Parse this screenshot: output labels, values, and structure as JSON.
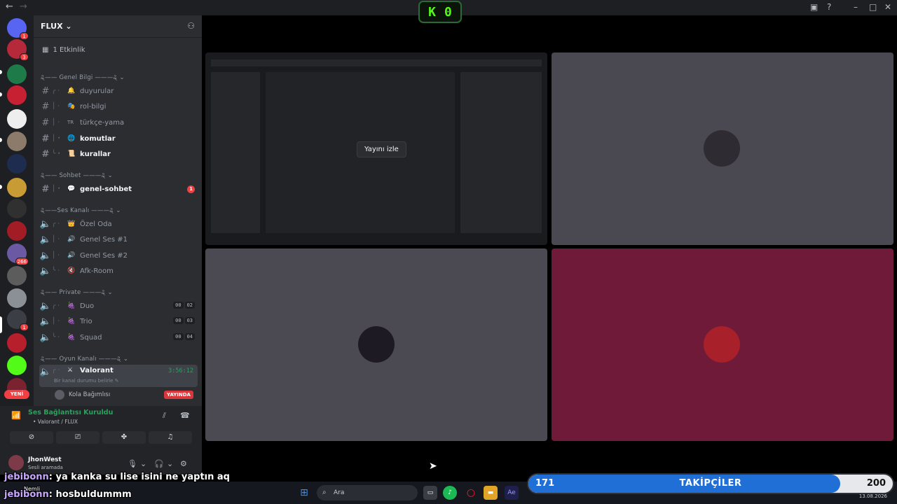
{
  "server": {
    "name": "FLUX",
    "events": "1 Etkinlik"
  },
  "guild_badges": {
    "discord": "1",
    "m": "3",
    "community": "266",
    "app": "1"
  },
  "new_label": "YENİ",
  "categories": {
    "genel": "ୡ—— Genel Bilgi ———ୡ ⌄",
    "sohbet": "ୡ—— Sohbet ———ୡ ⌄",
    "ses": "ୡ——Ses Kanalı ———ୡ ⌄",
    "private": "ୡ—— Private ———ୡ ⌄",
    "oyun": "ୡ—— Oyun Kanalı ———ୡ ⌄"
  },
  "channels": {
    "duyurular": "duyurular",
    "rol_bilgi": "rol-bilgi",
    "turkce_yama": "türkçe-yama",
    "turkce_prefix": "TR",
    "komutlar": "komutlar",
    "kurallar": "kurallar",
    "genel_sohbet": "genel-sohbet",
    "genel_sohbet_badge": "1",
    "ozel_oda": "Özel Oda",
    "genel_ses_1": "Genel Ses #1",
    "genel_ses_2": "Genel Ses #2",
    "afk_room": "Afk-Room",
    "duo": "Duo",
    "duo_count": [
      "00",
      "02"
    ],
    "trio": "Trio",
    "trio_count": [
      "00",
      "03"
    ],
    "squad": "Squad",
    "squad_count": [
      "00",
      "04"
    ],
    "valorant": "Valorant",
    "valorant_timer": "3:56:12",
    "valorant_status": "Bir kanal durumu belirle",
    "voice_user": "Kola Bağımlısı",
    "live_label": "YAYINDA"
  },
  "voice_panel": {
    "status": "Ses Bağlantısı Kuruldu",
    "location": "• Valorant / FLUX"
  },
  "user_panel": {
    "name": "JhonWest",
    "sub": "Sesli aramada"
  },
  "stream": {
    "watch_label": "Yayını izle"
  },
  "kick_badge": {
    "count": "0"
  },
  "chat_overlay": [
    {
      "user": "jebibonn",
      "text": ": ya kanka su lise isini ne yaptın aq"
    },
    {
      "user": "jebibonn",
      "text": ": hosbuldummm"
    }
  ],
  "chat_small": "Nemli",
  "taskbar": {
    "search": "Ara",
    "date": "13.08.2026"
  },
  "followers": {
    "label": "TAKİPÇİLER",
    "current": "171",
    "goal": "200",
    "progress": 0.855
  },
  "colors": {
    "accent_green": "#23a55a",
    "danger": "#f23f42",
    "kick_green": "#53fc18",
    "tile_maroon": "#6f1a38",
    "follower_blue": "#1f6fd6"
  }
}
